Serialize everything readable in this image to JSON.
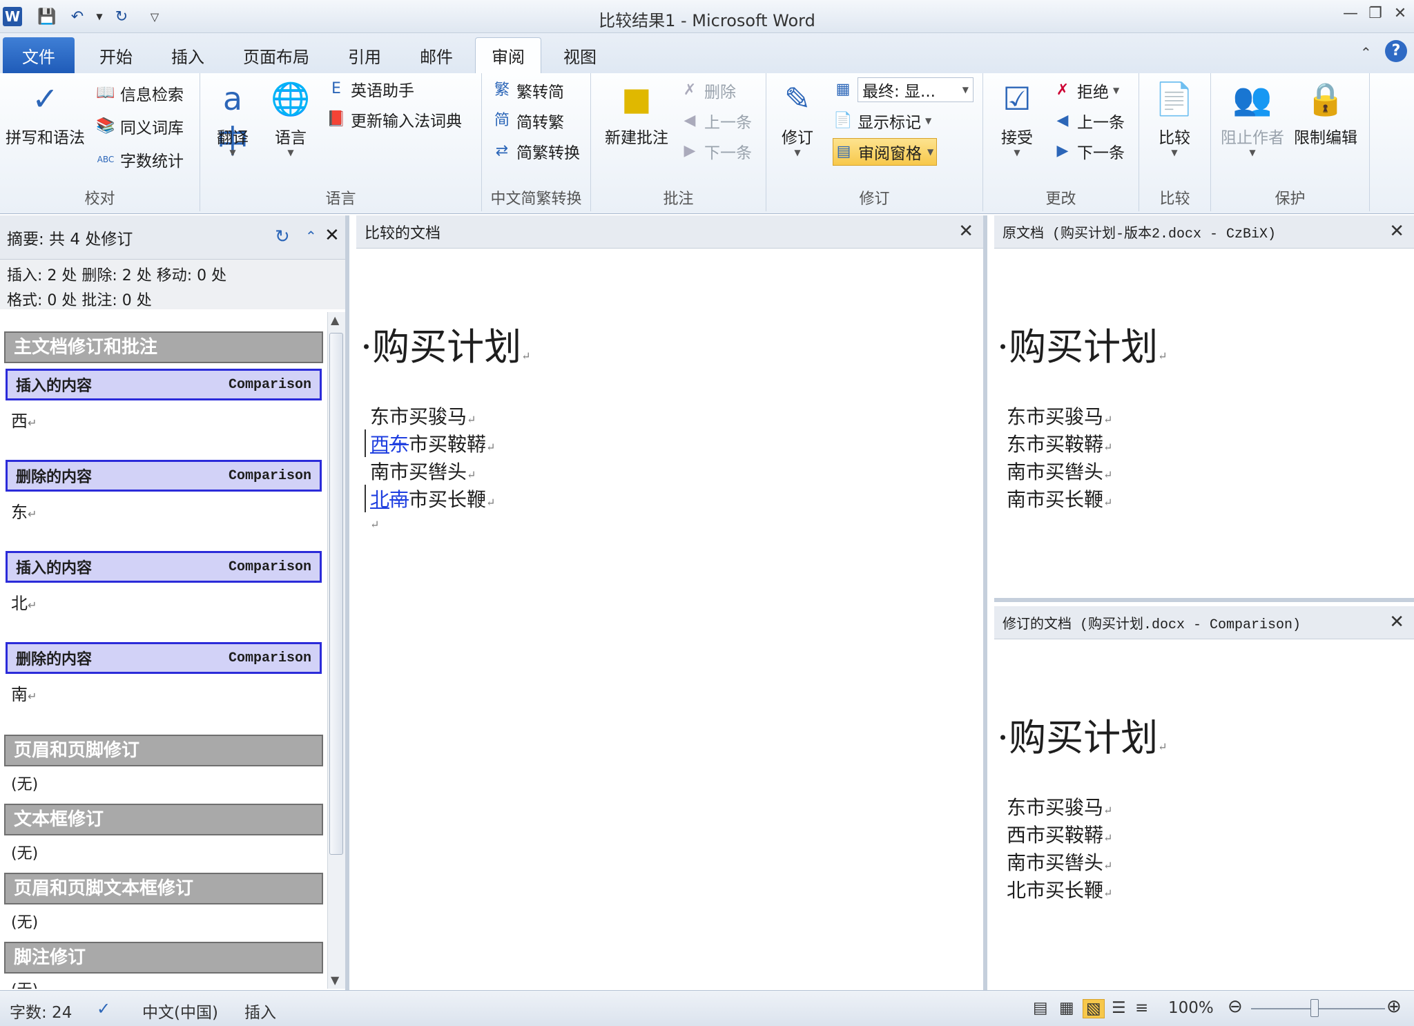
{
  "window": {
    "title": "比较结果1 - Microsoft Word"
  },
  "tabs": [
    "文件",
    "开始",
    "插入",
    "页面布局",
    "引用",
    "邮件",
    "审阅",
    "视图"
  ],
  "ribbon": {
    "proofing": {
      "label": "校对",
      "spell": "拼写和语法",
      "research": "信息检索",
      "thesaurus": "同义词库",
      "wordcount": "字数统计"
    },
    "language": {
      "label": "语言",
      "translate": "翻译",
      "lang": "语言",
      "english": "英语助手",
      "update": "更新输入法词典"
    },
    "chinese": {
      "label": "中文简繁转换",
      "t2s": "繁转简",
      "s2t": "简转繁",
      "convert": "简繁转换"
    },
    "comments": {
      "label": "批注",
      "new": "新建批注",
      "delete": "删除",
      "prev": "上一条",
      "next": "下一条"
    },
    "tracking": {
      "label": "修订",
      "track": "修订",
      "display": "最终: 显...",
      "markup": "显示标记",
      "pane": "审阅窗格"
    },
    "changes": {
      "label": "更改",
      "accept": "接受",
      "reject": "拒绝",
      "prev": "上一条",
      "next": "下一条"
    },
    "compare": {
      "label": "比较",
      "compare": "比较"
    },
    "protect": {
      "label": "保护",
      "block": "阻止作者",
      "restrict": "限制编辑"
    }
  },
  "review_pane": {
    "title": "摘要: 共 4 处修订",
    "stats1": "插入: 2 处 删除: 2 处 移动: 0 处",
    "stats2": "格式: 0 处 批注: 0 处",
    "main_section": "主文档修订和批注",
    "revisions": [
      {
        "type": "插入的内容",
        "author": "Comparison",
        "text": "西"
      },
      {
        "type": "删除的内容",
        "author": "Comparison",
        "text": "东"
      },
      {
        "type": "插入的内容",
        "author": "Comparison",
        "text": "北"
      },
      {
        "type": "删除的内容",
        "author": "Comparison",
        "text": "南"
      }
    ],
    "sections": [
      {
        "title": "页眉和页脚修订",
        "value": "(无)"
      },
      {
        "title": "文本框修订",
        "value": "(无)"
      },
      {
        "title": "页眉和页脚文本框修订",
        "value": "(无)"
      },
      {
        "title": "脚注修订",
        "value": "(无)"
      }
    ]
  },
  "compared": {
    "header": "比较的文档",
    "title": "购买计划",
    "l1": "东市买骏马",
    "l2a": "西",
    "l2b": "东",
    "l2c": "市买鞍鞯",
    "l3": "南市买辔头",
    "l4a": "北",
    "l4b": "南",
    "l4c": "市买长鞭"
  },
  "original": {
    "header": "原文档 (购买计划-版本2.docx - CzBiX)",
    "title": "购买计划",
    "lines": [
      "东市买骏马",
      "东市买鞍鞯",
      "南市买辔头",
      "南市买长鞭"
    ]
  },
  "revised": {
    "header": "修订的文档 (购买计划.docx - Comparison)",
    "title": "购买计划",
    "lines": [
      "东市买骏马",
      "西市买鞍鞯",
      "南市买辔头",
      "北市买长鞭"
    ]
  },
  "status": {
    "words": "字数: 24",
    "lang": "中文(中国)",
    "mode": "插入",
    "zoom": "100%"
  }
}
